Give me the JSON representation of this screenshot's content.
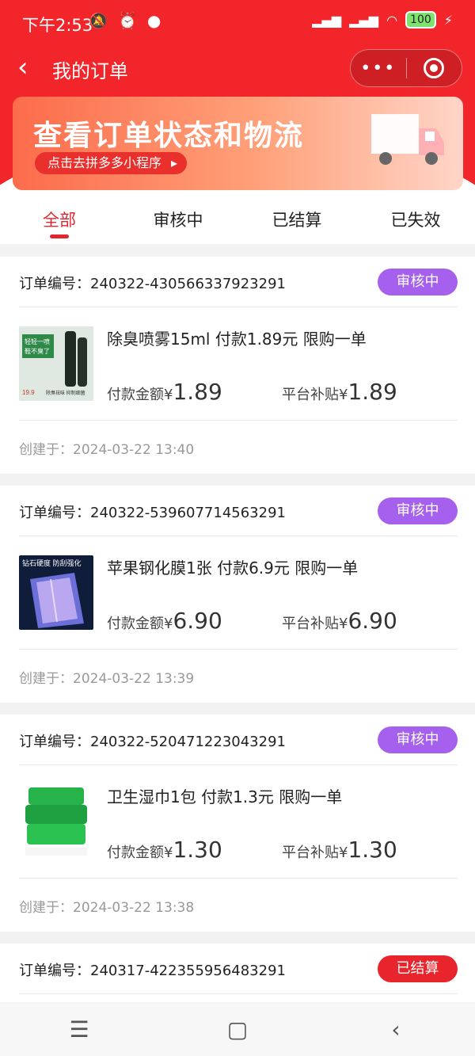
{
  "status_bar": {
    "time": "下午2:53",
    "battery": "100"
  },
  "nav": {
    "title": "我的订单"
  },
  "banner": {
    "title": "查看订单状态和物流",
    "button": "点击去拼多多小程序"
  },
  "tabs": [
    "全部",
    "审核中",
    "已结算",
    "已失效"
  ],
  "order_label": "订单编号：",
  "labels": {
    "paid": "付款金额",
    "subsidy": "平台补贴",
    "currency": "¥",
    "created": "创建于："
  },
  "orders": [
    {
      "order_no": "240322-430566337923291",
      "status": "审核中",
      "product": "除臭喷雾15ml 付款1.89元 限购一单",
      "paid": "1.89",
      "subsidy": "1.89",
      "created": "2024-03-22 13:40",
      "thumb_text": [
        "轻轻一喷",
        "鞋不臭了",
        "19.9",
        "除臭祛味 抑制细菌"
      ]
    },
    {
      "order_no": "240322-539607714563291",
      "status": "审核中",
      "product": "苹果钢化膜1张 付款6.9元 限购一单",
      "paid": "6.90",
      "subsidy": "6.90",
      "created": "2024-03-22 13:39",
      "thumb_text": [
        "钻石硬度 防刮强化"
      ]
    },
    {
      "order_no": "240322-520471223043291",
      "status": "审核中",
      "product": "卫生湿巾1包 付款1.3元 限购一单",
      "paid": "1.30",
      "subsidy": "1.30",
      "created": "2024-03-22 13:38",
      "thumb_text": []
    },
    {
      "order_no": "240317-422355956483291",
      "status": "已结算"
    }
  ],
  "colors": {
    "primary_red": "#f2252b",
    "badge_review": "#a660ee",
    "badge_settled": "#e8242c"
  }
}
